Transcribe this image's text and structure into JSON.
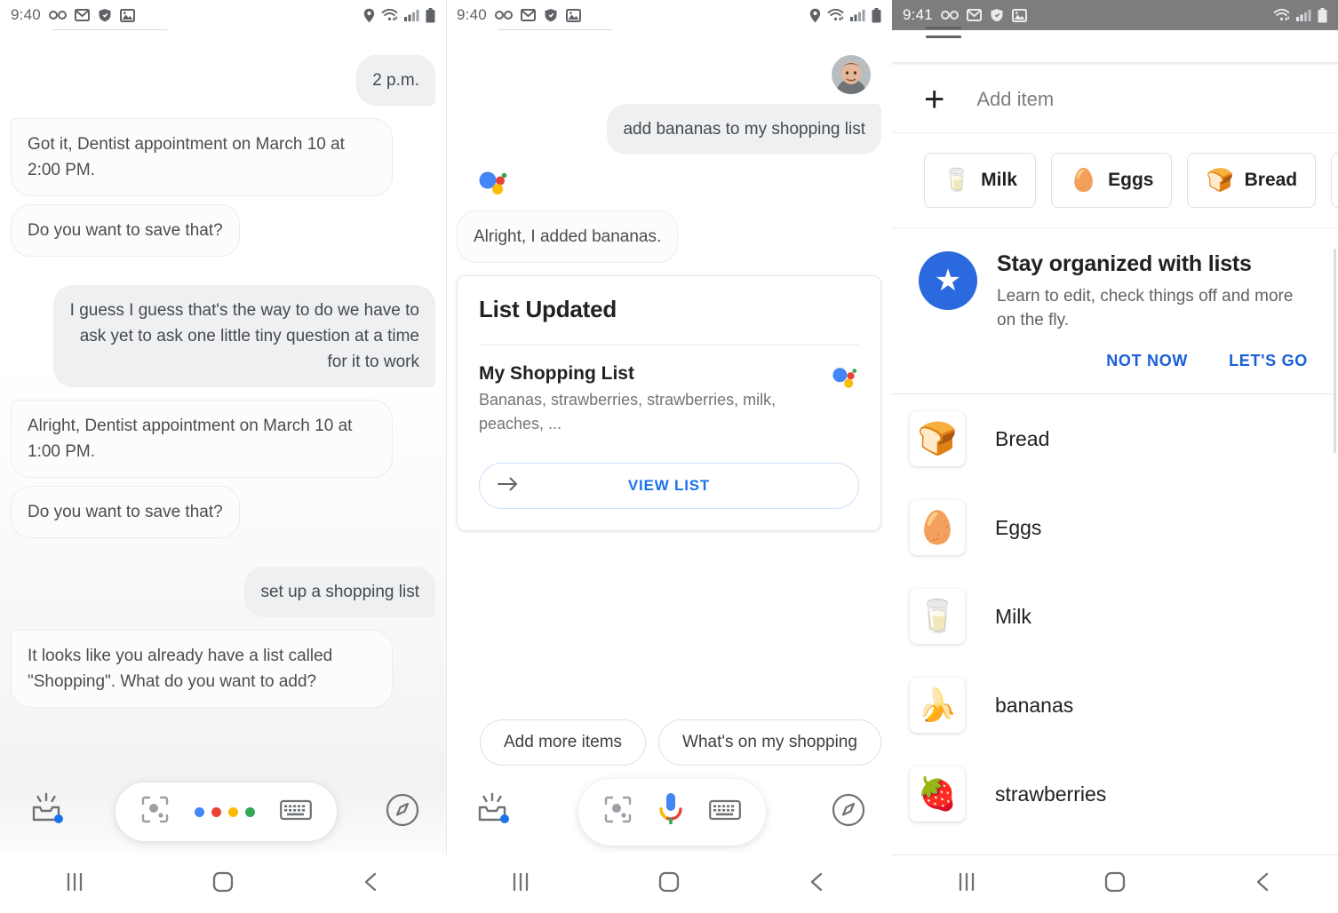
{
  "panel1": {
    "status_bar": {
      "time": "9:40",
      "left_icons": [
        "voicemail-icon",
        "gmail-icon",
        "play-protect-icon",
        "photos-icon"
      ],
      "right_icons": [
        "location-icon",
        "wifi-icon",
        "signal-icon",
        "battery-icon"
      ]
    },
    "messages": [
      {
        "from": "user",
        "style": "grey",
        "text": "2 p.m."
      },
      {
        "from": "assistant",
        "style": "card",
        "text": "Got it, Dentist appointment on March 10 at 2:00 PM."
      },
      {
        "from": "assistant",
        "style": "pill",
        "text": "Do you want to save that?"
      },
      {
        "from": "user",
        "style": "grey",
        "text": "I guess I guess that's the way to do we have to ask yet to ask one little tiny question at a time for it to work"
      },
      {
        "from": "assistant",
        "style": "card",
        "text": "Alright, Dentist appointment on March 10 at 1:00 PM."
      },
      {
        "from": "assistant",
        "style": "pill",
        "text": "Do you want to save that?"
      },
      {
        "from": "user",
        "style": "grey",
        "text": "set up a shopping list"
      },
      {
        "from": "assistant",
        "style": "card",
        "text": "It looks like you already have a list called \"Shopping\". What do you want to add?"
      }
    ],
    "bottom_bar": {
      "updates_label": "updates-inbox-icon",
      "lens_label": "google-lens-icon",
      "center_state": "four-dots-idle",
      "keyboard_label": "keyboard-icon",
      "explore_label": "explore-compass-icon"
    },
    "nav_bar": {
      "recents": "recents-icon",
      "home": "home-icon",
      "back": "back-icon"
    }
  },
  "panel2": {
    "status_bar": {
      "time": "9:40",
      "left_icons": [
        "voicemail-icon",
        "gmail-icon",
        "play-protect-icon",
        "photos-icon"
      ],
      "right_icons": [
        "location-icon",
        "wifi-icon",
        "signal-icon",
        "battery-icon"
      ]
    },
    "avatar": "user-avatar",
    "messages": [
      {
        "from": "user",
        "style": "grey",
        "text": "add bananas to my shopping list"
      },
      {
        "from": "assistant",
        "style": "pill",
        "text": "Alright, I added bananas."
      }
    ],
    "assistant_logo": "google-assistant-dots-icon",
    "card": {
      "title": "List Updated",
      "list_name": "My Shopping List",
      "list_items_preview": "Bananas, strawberries, strawberries, milk, peaches, ...",
      "logo": "google-assistant-dots-icon",
      "button_label": "VIEW LIST",
      "button_icon": "arrow-right-icon",
      "button_color": "#1a73e8"
    },
    "chips": [
      "Add more items",
      "What's on my shopping"
    ],
    "bottom_bar": {
      "updates_label": "updates-inbox-icon",
      "lens_label": "google-lens-icon",
      "center_state": "microphone-active",
      "keyboard_label": "keyboard-icon",
      "explore_label": "explore-compass-icon"
    },
    "nav_bar": {
      "recents": "recents-icon",
      "home": "home-icon",
      "back": "back-icon"
    }
  },
  "panel3": {
    "status_bar": {
      "time": "9:41",
      "left_icons": [
        "voicemail-icon",
        "gmail-icon",
        "play-protect-icon",
        "photos-icon"
      ],
      "right_icons": [
        "wifi-icon",
        "signal-icon",
        "battery-icon"
      ],
      "background": "#7d7d7d"
    },
    "app_bar": {
      "menu": "hamburger-menu-icon"
    },
    "add_item": {
      "icon": "plus-icon",
      "placeholder": "Add item"
    },
    "suggestions": [
      {
        "label": "Milk",
        "emoji": "🥛"
      },
      {
        "label": "Eggs",
        "emoji": "🥚"
      },
      {
        "label": "Bread",
        "emoji": "🍞"
      },
      {
        "label": "",
        "emoji": "🧈"
      }
    ],
    "promo": {
      "icon": "star-icon",
      "icon_color": "#2b6ade",
      "title": "Stay organized with lists",
      "body": "Learn to edit, check things off and more on the fly.",
      "secondary_action": "NOT NOW",
      "primary_action": "LET'S GO",
      "action_color": "#1a5ed9"
    },
    "list_items": [
      {
        "label": "Bread",
        "emoji": "🍞"
      },
      {
        "label": "Eggs",
        "emoji": "🥚"
      },
      {
        "label": "Milk",
        "emoji": "🥛"
      },
      {
        "label": "bananas",
        "emoji": "🍌"
      },
      {
        "label": "strawberries",
        "emoji": "🍓"
      }
    ],
    "nav_bar": {
      "recents": "recents-icon",
      "home": "home-icon",
      "back": "back-icon"
    }
  }
}
